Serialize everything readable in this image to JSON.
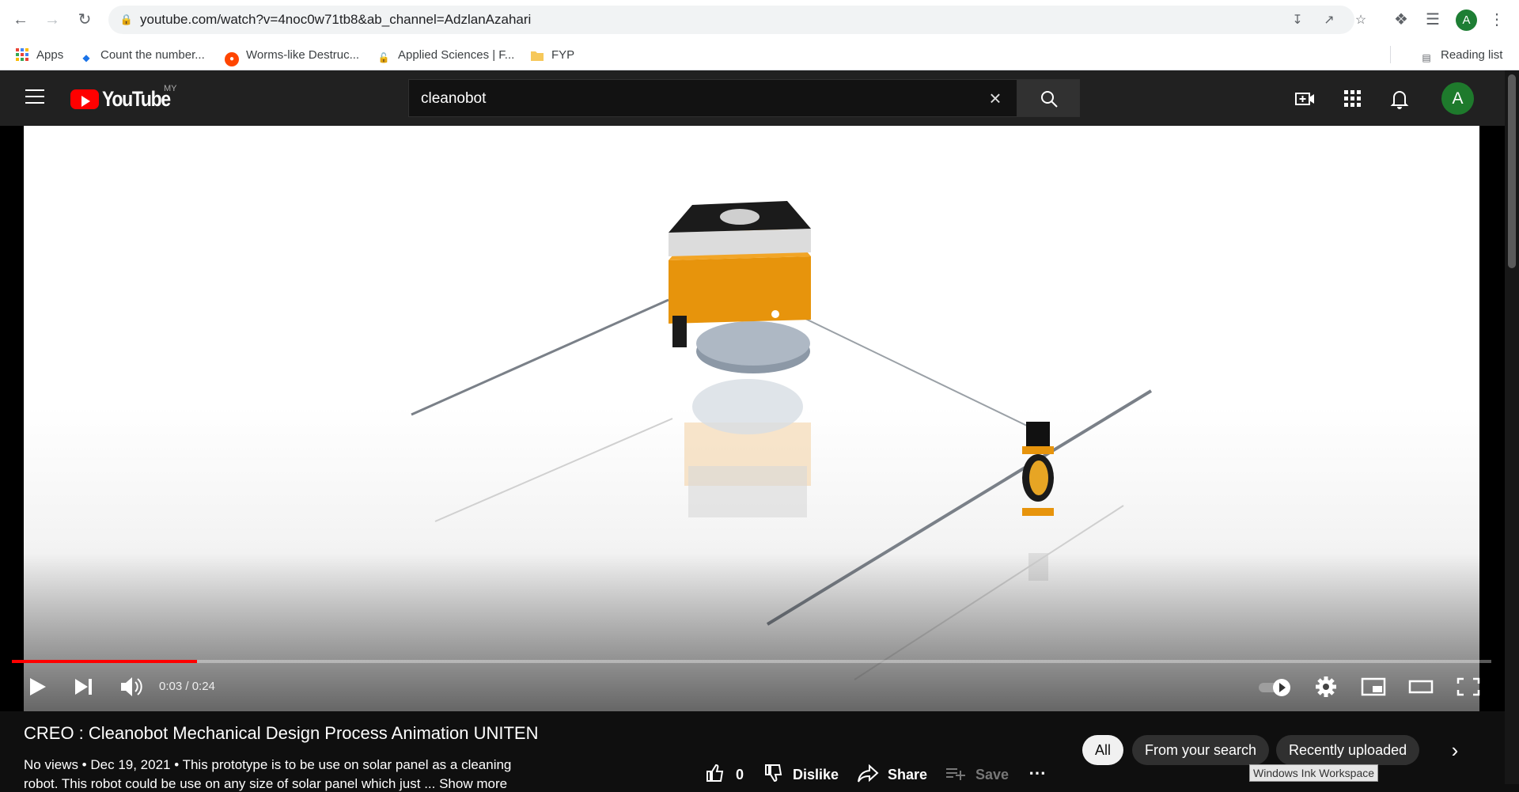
{
  "browser": {
    "url": "youtube.com/watch?v=4noc0w71tb8&ab_channel=AdzlanAzahari",
    "profile_initial": "A",
    "bookmarks": [
      {
        "label": "Apps",
        "icon": "apps-grid-icon"
      },
      {
        "label": "Count the number...",
        "icon": "diamond-icon"
      },
      {
        "label": "Worms-like Destruc...",
        "icon": "reddit-icon"
      },
      {
        "label": "Applied Sciences | F...",
        "icon": "lock-icon"
      },
      {
        "label": "FYP",
        "icon": "folder-icon"
      }
    ],
    "reading_list": "Reading list"
  },
  "youtube": {
    "logo_text": "YouTube",
    "region": "MY",
    "search_value": "cleanobot",
    "avatar_initial": "A"
  },
  "player": {
    "time_display": "0:03 / 0:24",
    "progress_fraction": 0.125
  },
  "video": {
    "title": "CREO : Cleanobot Mechanical Design Process Animation UNITEN",
    "meta": "No views • Dec 19, 2021 • This prototype is to be use on solar panel as a cleaning",
    "desc_line2": "robot. This robot could be use on any size of solar panel which just ... Show more"
  },
  "actions": {
    "like_count": "0",
    "dislike": "Dislike",
    "share": "Share",
    "save": "Save"
  },
  "chips": [
    "All",
    "From your search",
    "Recently uploaded"
  ],
  "tooltip": "Windows Ink Workspace",
  "colors": {
    "accent": "#ff0000",
    "header_bg": "#212121",
    "page_bg": "#0f0f0f"
  }
}
